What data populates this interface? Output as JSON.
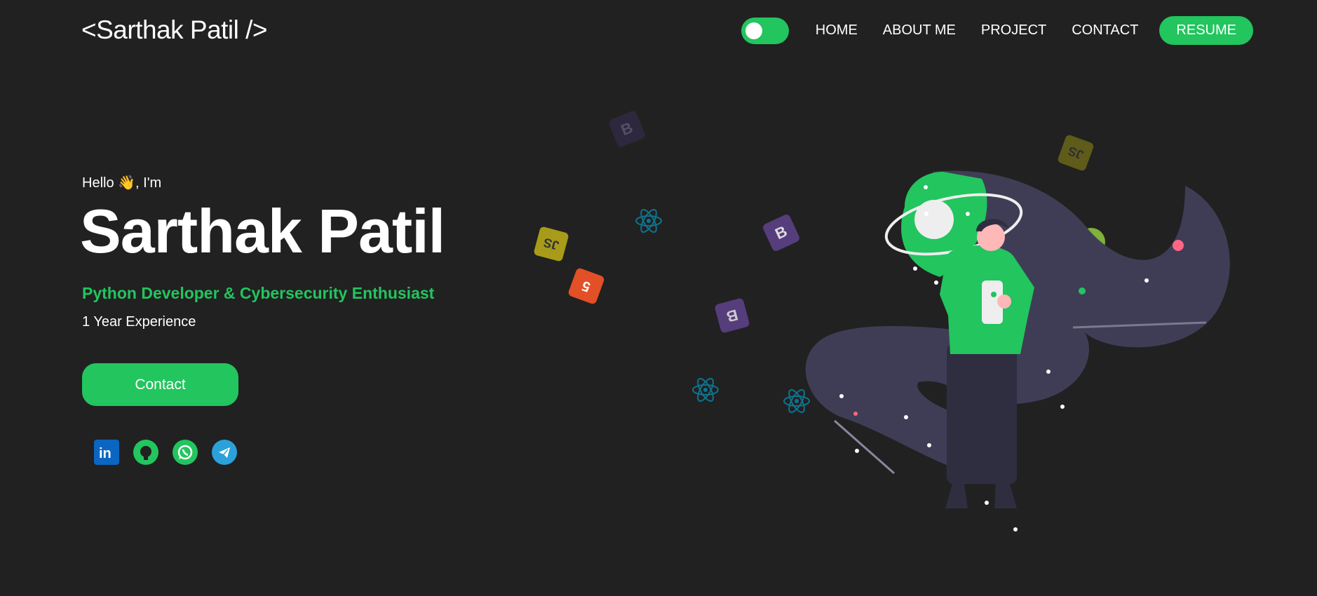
{
  "header": {
    "logo": "<Sarthak Patil />",
    "nav": [
      "HOME",
      "ABOUT ME",
      "PROJECT",
      "CONTACT"
    ],
    "resume_label": "RESUME",
    "theme_toggle": "on"
  },
  "hero": {
    "greeting_prefix": "Hello",
    "greeting_emoji": "👋",
    "greeting_suffix": ", I'm",
    "name": "Sarthak Patil",
    "role": "Python Developer & Cybersecurity Enthusiast",
    "experience": "1 Year Experience",
    "contact_label": "Contact"
  },
  "socials": [
    {
      "name": "linkedin-icon"
    },
    {
      "name": "github-icon"
    },
    {
      "name": "whatsapp-icon"
    },
    {
      "name": "telegram-icon"
    }
  ],
  "colors": {
    "background": "#212121",
    "accent": "#22c55e",
    "text": "#ffffff",
    "blob": "#3f3d56",
    "pink": "#ff6584"
  }
}
